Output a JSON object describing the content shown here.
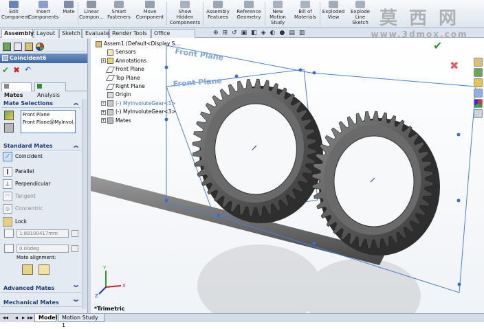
{
  "toolbar": {
    "items": [
      {
        "label": "Edit\nComponent",
        "icon": "edit-component-icon",
        "color": "#6b84b6"
      },
      {
        "label": "Insert\nComponents",
        "icon": "insert-components-icon",
        "color": "#8aa0c8"
      },
      {
        "label": "Mate",
        "icon": "mate-icon",
        "color": "#7f8ea8"
      },
      {
        "label": "Linear\nCompon...",
        "icon": "linear-pattern-icon",
        "color": "#8d96a5"
      },
      {
        "label": "Smart\nFasteners",
        "icon": "smart-fasteners-icon",
        "color": "#9ba4b1"
      },
      {
        "label": "Move\nComponent",
        "icon": "move-component-icon",
        "color": "#94a0b0"
      },
      {
        "label": "Show\nHidden\nComponents",
        "icon": "show-hidden-icon",
        "color": "#a6b0bf"
      },
      {
        "label": "Assembly\nFeatures",
        "icon": "assembly-features-icon",
        "color": "#9ca6b5"
      },
      {
        "label": "Reference\nGeometry",
        "icon": "reference-geometry-icon",
        "color": "#a0aab8"
      },
      {
        "label": "New\nMotion\nStudy",
        "icon": "motion-study-icon",
        "color": "#a8b1be"
      },
      {
        "label": "Bill of\nMaterials",
        "icon": "bill-of-materials-icon",
        "color": "#aab3c0"
      },
      {
        "label": "Exploded\nView",
        "icon": "exploded-view-icon",
        "color": "#a3acb9"
      },
      {
        "label": "Explode\nLine\nSketch",
        "icon": "explode-line-sketch-icon",
        "color": "#a7b0bd"
      }
    ]
  },
  "watermark": {
    "cn": "莫 西 网",
    "url": "www.3dmox.com"
  },
  "tabs": [
    "Assembly",
    "Layout",
    "Sketch",
    "Evaluate",
    "Render Tools",
    "Office Products"
  ],
  "panel": {
    "title": "Coincident6",
    "mates_tab": "Mates",
    "analysis_tab": "Analysis",
    "mate_selections": {
      "heading": "Mate Selections",
      "items": [
        "Front Plane",
        "Front Plane@MyInvol..."
      ]
    },
    "standard_mates": {
      "heading": "Standard Mates",
      "items": [
        {
          "label": "Coincident",
          "enabled": true,
          "icon": "coincident-icon"
        },
        {
          "label": "Parallel",
          "enabled": true,
          "icon": "parallel-icon"
        },
        {
          "label": "Perpendicular",
          "enabled": true,
          "icon": "perpendicular-icon"
        },
        {
          "label": "Tangent",
          "enabled": false,
          "icon": "tangent-icon"
        },
        {
          "label": "Concentric",
          "enabled": false,
          "icon": "concentric-icon"
        },
        {
          "label": "Lock",
          "enabled": true,
          "icon": "lock-icon"
        }
      ],
      "distance_value": "1.88100417mm",
      "angle_value": "0.00deg",
      "alignment_label": "Mate alignment:"
    },
    "advanced_mates": "Advanced Mates",
    "mechanical_mates": "Mechanical Mates"
  },
  "tree": {
    "items": [
      {
        "label": "Assem1  (Default<Display S...",
        "style": "normal",
        "icon": "assembly-icon"
      },
      {
        "label": "Sensors",
        "style": "normal",
        "icon": "sensors-icon"
      },
      {
        "label": "Annotations",
        "style": "normal",
        "icon": "annotations-icon"
      },
      {
        "label": "Front Plane",
        "style": "normal",
        "icon": "plane-icon"
      },
      {
        "label": "Top Plane",
        "style": "normal",
        "icon": "plane-icon"
      },
      {
        "label": "Right Plane",
        "style": "normal",
        "icon": "plane-icon"
      },
      {
        "label": "Origin",
        "style": "normal",
        "icon": "origin-icon"
      },
      {
        "label": "(-) MyInvoluteGear<1>",
        "style": "blue",
        "icon": "part-icon"
      },
      {
        "label": "(-) MyInvoluteGear<3>",
        "style": "normal",
        "icon": "part-icon"
      },
      {
        "label": "Mates",
        "style": "normal",
        "icon": "mates-icon"
      }
    ]
  },
  "viewport": {
    "plane_label_1": "Front Plane",
    "plane_label_2": "Front Plane",
    "view_name": "*Trimetric",
    "gear_teeth": 40,
    "accept_color": "#2f9a2f",
    "cancel_color": "#d04040"
  },
  "status": {
    "tabs": [
      "Model",
      "Motion Study 1"
    ]
  }
}
